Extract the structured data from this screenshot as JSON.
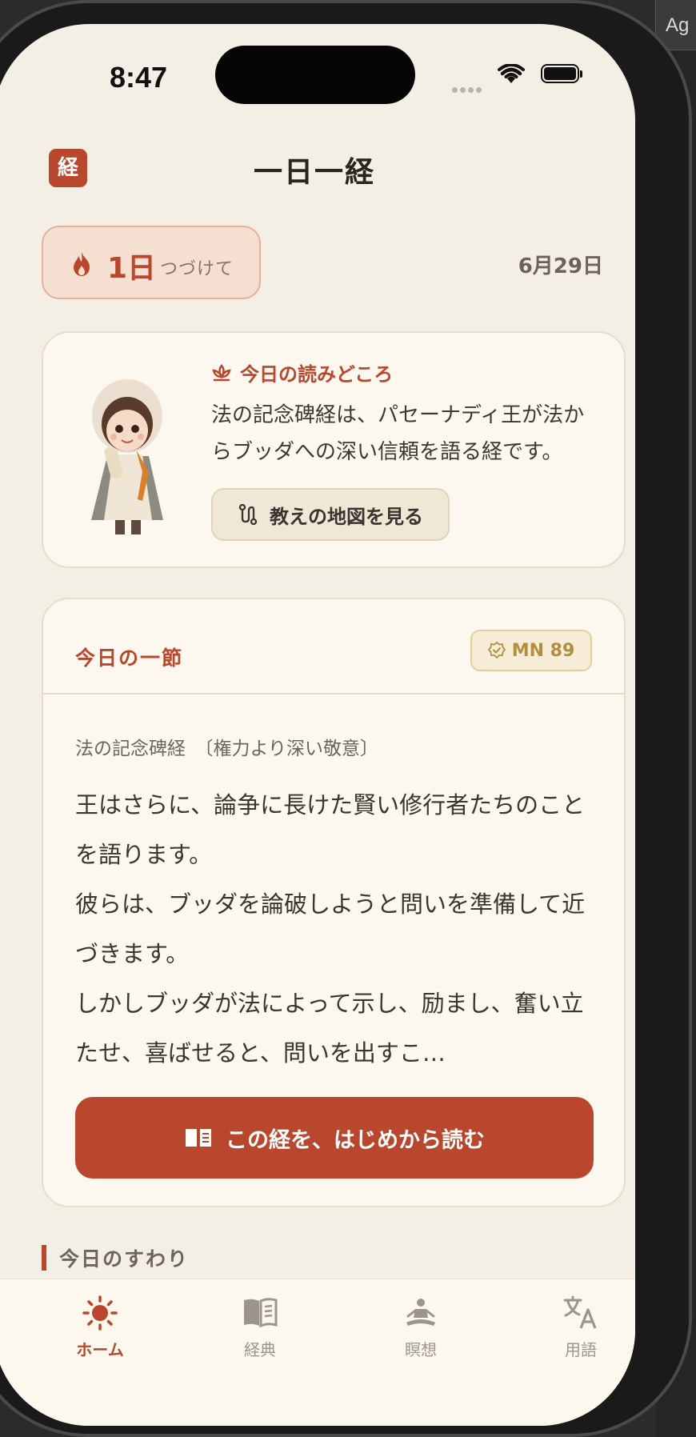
{
  "desktop": {
    "label": "Ag"
  },
  "status_bar": {
    "time": "8:47"
  },
  "header": {
    "logo_char": "経",
    "title": "一日一経"
  },
  "streak": {
    "count": "1日",
    "label": "つづけて"
  },
  "date": "6月29日",
  "highlight_card": {
    "heading": "今日の読みどころ",
    "body": "法の記念碑経は、パセーナディ王が法からブッダへの深い信頼を語る経です。",
    "map_button": "教えの地図を見る"
  },
  "verse_card": {
    "title": "今日の一節",
    "badge": "MN 89",
    "subtitle": "法の記念碑経　〔権力より深い敬意〕",
    "paragraphs": [
      "王はさらに、論争に長けた賢い修行者たちのことを語ります。",
      "彼らは、ブッダを論破しようと問いを準備して近づきます。",
      "しかしブッダが法によって示し、励まし、奮い立たせ、喜ばせると、問いを出すこ…"
    ],
    "read_button": "この経を、はじめから読む"
  },
  "section": {
    "label": "今日のすわり"
  },
  "tabs": [
    {
      "label": "ホーム",
      "icon": "sun-icon",
      "active": true
    },
    {
      "label": "経典",
      "icon": "book-icon",
      "active": false
    },
    {
      "label": "瞑想",
      "icon": "meditation-icon",
      "active": false
    },
    {
      "label": "用語",
      "icon": "translate-icon",
      "active": false
    }
  ],
  "colors": {
    "accent": "#b8472d",
    "background": "#f4efe4",
    "card": "#fcf8ef",
    "badge": "#b0903f"
  }
}
